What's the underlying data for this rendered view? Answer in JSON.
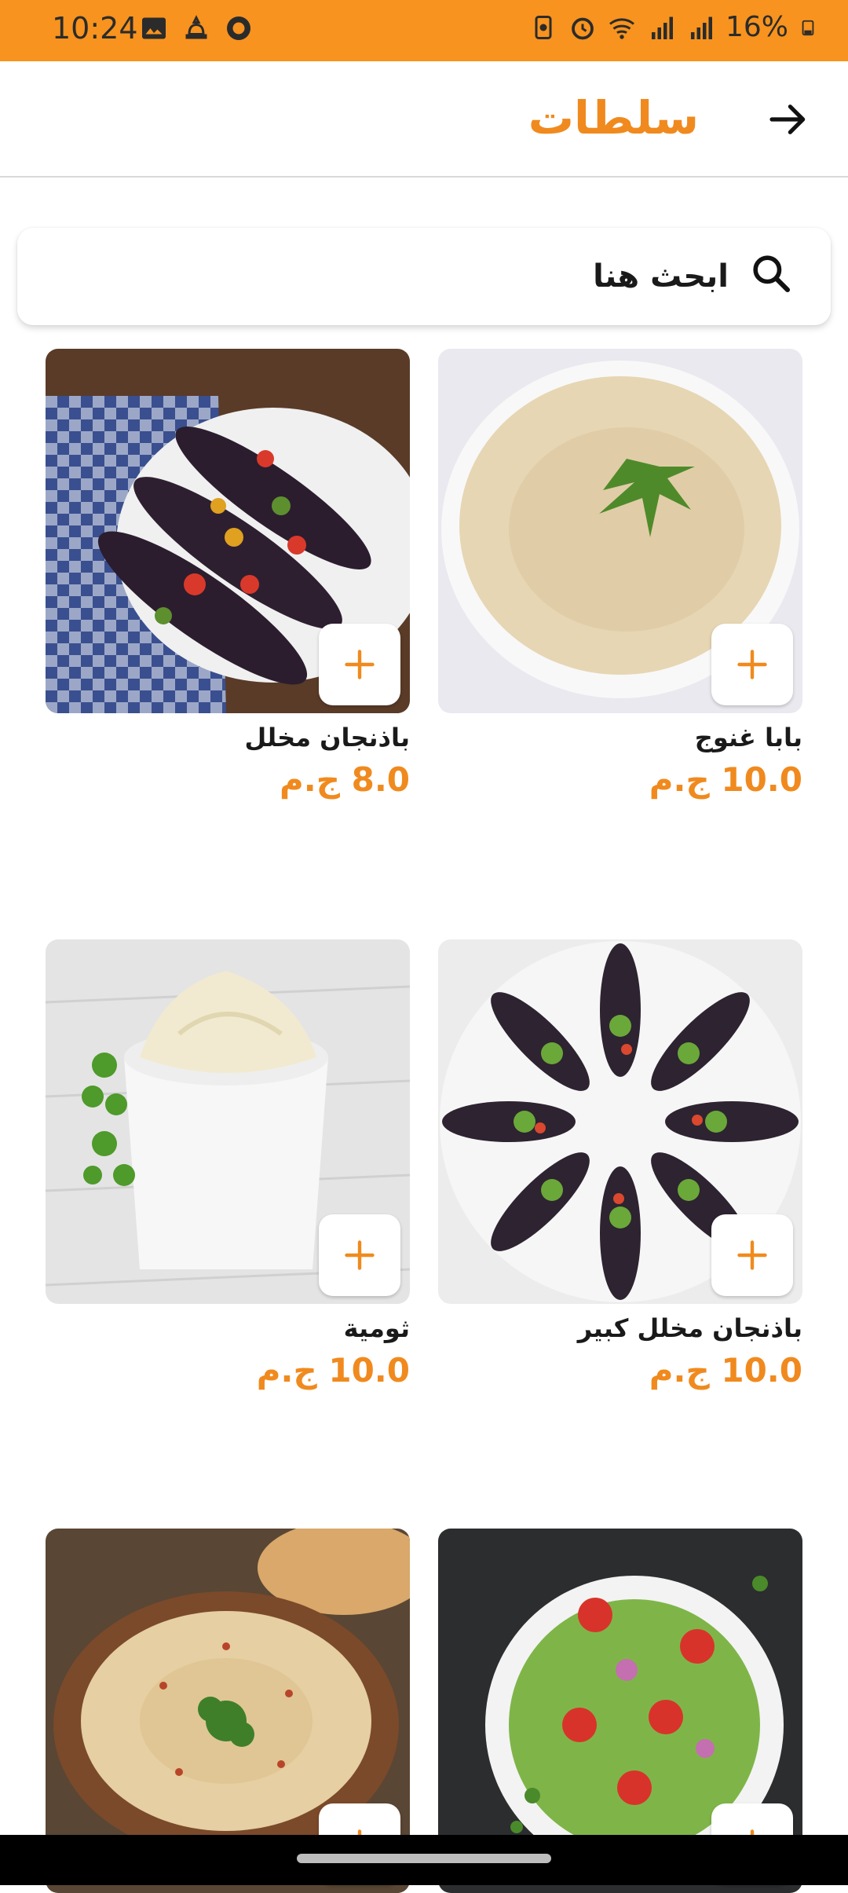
{
  "status_bar": {
    "time": "10:24",
    "battery": "16%",
    "left_icons": [
      "image-icon",
      "notification-bell-icon",
      "whatsapp-icon"
    ],
    "right_icons": [
      "battery-saver-icon",
      "alarm-icon",
      "wifi-icon",
      "signal-icon",
      "signal-icon",
      "battery-icon"
    ]
  },
  "header": {
    "title": "سلطات",
    "back_icon": "arrow-right-icon"
  },
  "search": {
    "placeholder": "ابحث هنا",
    "icon": "search-icon"
  },
  "colors": {
    "accent": "#F7931E",
    "price": "#F08A1E"
  },
  "products": [
    {
      "name": "بابا غنوج",
      "price": "10.0 ج.م"
    },
    {
      "name": "باذنجان مخلل",
      "price": "8.0 ج.م"
    },
    {
      "name": "باذنجان مخلل كبير",
      "price": "10.0 ج.م"
    },
    {
      "name": "ثومية",
      "price": "10.0 ج.م"
    },
    {
      "name": "",
      "price": ""
    },
    {
      "name": "",
      "price": ""
    }
  ]
}
